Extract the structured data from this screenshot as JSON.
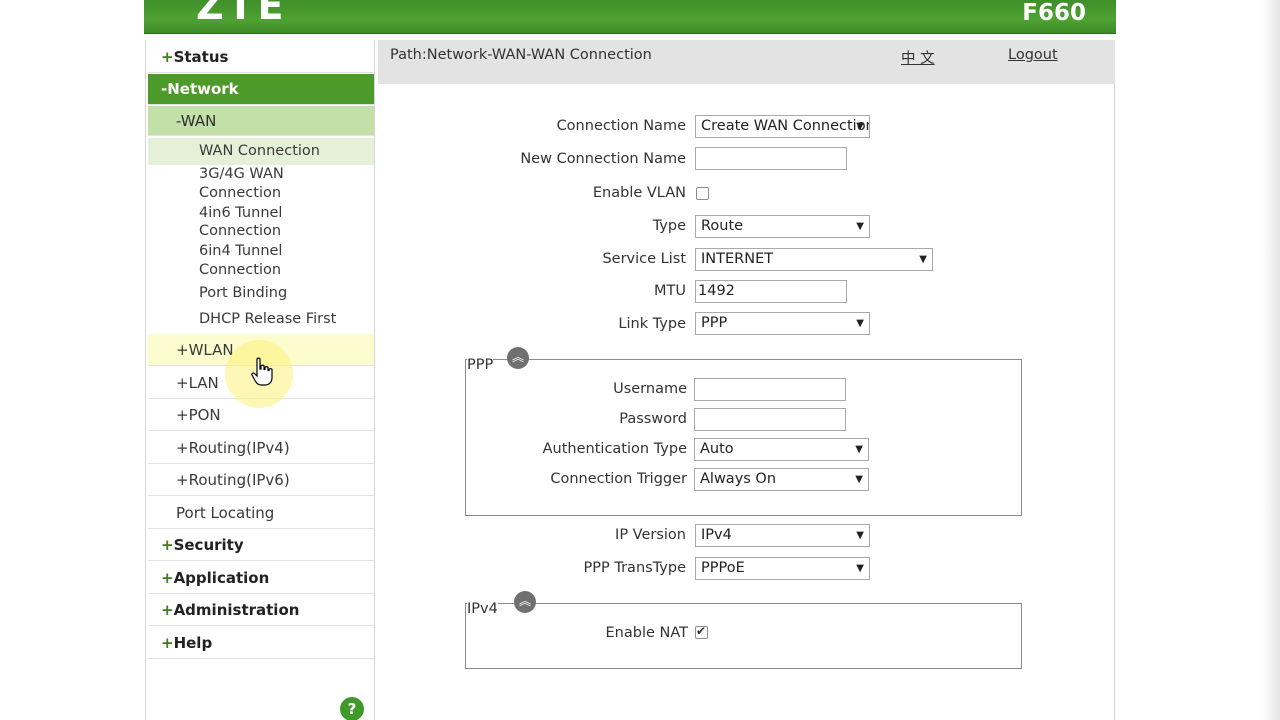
{
  "header": {
    "logo": "ZTE",
    "model": "F660"
  },
  "path": {
    "text": "Path:Network-WAN-WAN Connection",
    "lang_link": "中 文",
    "logout": "Logout"
  },
  "sidebar": {
    "status": "Status",
    "network": "-Network",
    "wan": "-WAN",
    "wan_items": [
      "WAN Connection",
      "3G/4G WAN",
      "Connection",
      "4in6 Tunnel",
      "Connection",
      "6in4 Tunnel",
      "Connection",
      "Port Binding",
      "DHCP Release First"
    ],
    "wlan": "WLAN",
    "lan": "LAN",
    "pon": "PON",
    "routing4": "Routing(IPv4)",
    "routing6": "Routing(IPv6)",
    "port_locating": "Port Locating",
    "security": "Security",
    "application": "Application",
    "administration": "Administration",
    "help": "Help",
    "plus": "+",
    "help_icon": "?"
  },
  "form": {
    "connection_name_label": "Connection Name",
    "connection_name_value": "Create WAN Connection",
    "new_connection_name_label": "New Connection Name",
    "new_connection_name_value": "",
    "enable_vlan_label": "Enable VLAN",
    "type_label": "Type",
    "type_value": "Route",
    "service_list_label": "Service List",
    "service_list_value": "INTERNET",
    "mtu_label": "MTU",
    "mtu_value": "1492",
    "link_type_label": "Link Type",
    "link_type_value": "PPP",
    "ppp_legend": "PPP",
    "username_label": "Username",
    "password_label": "Password",
    "auth_type_label": "Authentication Type",
    "auth_type_value": "Auto",
    "conn_trigger_label": "Connection Trigger",
    "conn_trigger_value": "Always On",
    "ip_version_label": "IP Version",
    "ip_version_value": "IPv4",
    "ppp_transtype_label": "PPP TransType",
    "ppp_transtype_value": "PPPoE",
    "ipv4_legend": "IPv4",
    "enable_nat_label": "Enable NAT",
    "enable_nat_checked": true,
    "enable_vlan_checked": false
  },
  "colors": {
    "brand_green": "#4b9a2a",
    "wan_green": "#c3e0a8",
    "hover_yellow": "#fdfccf"
  },
  "icons": {
    "collapse": "double-chevron-up-icon",
    "dropdown": "triangle-down-icon",
    "cursor": "hand-pointer-icon"
  }
}
